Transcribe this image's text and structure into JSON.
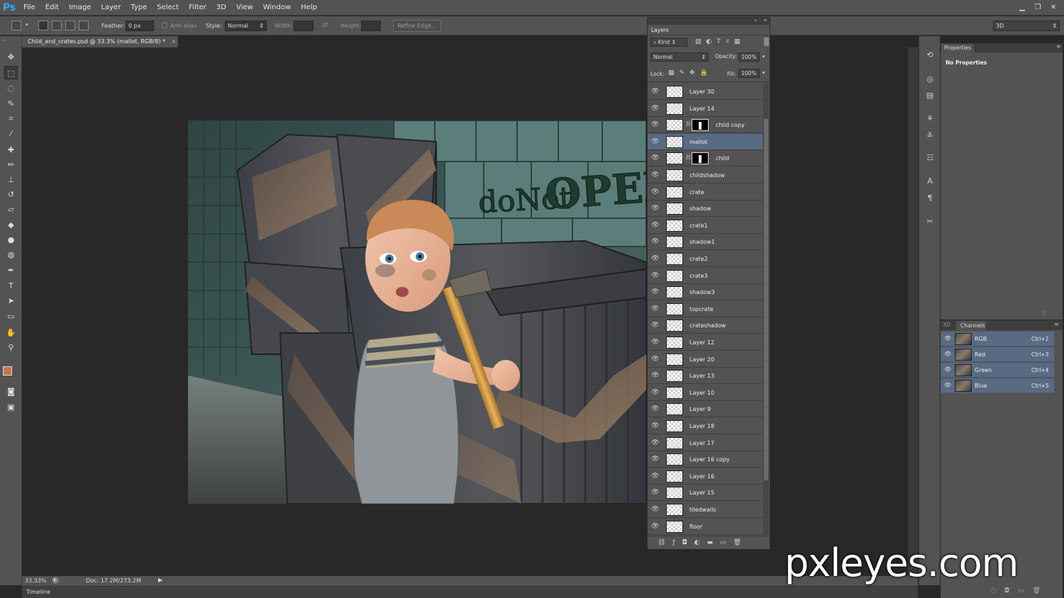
{
  "app": {
    "logo": "Ps",
    "menu": [
      "File",
      "Edit",
      "Image",
      "Layer",
      "Type",
      "Select",
      "Filter",
      "3D",
      "View",
      "Window",
      "Help"
    ]
  },
  "options": {
    "feather_label": "Feather:",
    "feather_value": "0 px",
    "antialias_label": "Anti-alias",
    "style_label": "Style:",
    "style_value": "Normal",
    "width_label": "Width:",
    "height_label": "Height:",
    "refine_edge": "Refine Edge...",
    "workspace": "3D"
  },
  "document": {
    "tab_title": "Child_and_crates.psd @ 33.3% (mallot, RGB/8) *",
    "close": "×",
    "sign_text_1": "doNot",
    "sign_text_2": "OPEN"
  },
  "status": {
    "zoom": "33.33%",
    "doc": "Doc: 17.2M/273.2M",
    "timeline": "Timeline"
  },
  "layers_panel": {
    "tab": "Layers",
    "kind": "Kind",
    "blend_mode": "Normal",
    "opacity_label": "Opacity:",
    "opacity_value": "100%",
    "lock_label": "Lock:",
    "fill_label": "Fill:",
    "fill_value": "100%",
    "layers": [
      {
        "name": "Layer 30",
        "selected": false,
        "mask": false
      },
      {
        "name": "Layer 14",
        "selected": false,
        "mask": false
      },
      {
        "name": "child copy",
        "selected": false,
        "mask": true
      },
      {
        "name": "mallot",
        "selected": true,
        "mask": false
      },
      {
        "name": "child",
        "selected": false,
        "mask": true
      },
      {
        "name": "childshadow",
        "selected": false,
        "mask": false
      },
      {
        "name": "crate",
        "selected": false,
        "mask": false
      },
      {
        "name": "shadow",
        "selected": false,
        "mask": false
      },
      {
        "name": "crate1",
        "selected": false,
        "mask": false
      },
      {
        "name": "shadow1",
        "selected": false,
        "mask": false
      },
      {
        "name": "crate2",
        "selected": false,
        "mask": false
      },
      {
        "name": "crate3",
        "selected": false,
        "mask": false
      },
      {
        "name": "shadow3",
        "selected": false,
        "mask": false
      },
      {
        "name": "topcrate",
        "selected": false,
        "mask": false
      },
      {
        "name": "crateshadow",
        "selected": false,
        "mask": false
      },
      {
        "name": "Layer 12",
        "selected": false,
        "mask": false
      },
      {
        "name": "Layer 20",
        "selected": false,
        "mask": false
      },
      {
        "name": "Layer 13",
        "selected": false,
        "mask": false
      },
      {
        "name": "Layer 10",
        "selected": false,
        "mask": false
      },
      {
        "name": "Layer 9",
        "selected": false,
        "mask": false
      },
      {
        "name": "Layer 18",
        "selected": false,
        "mask": false
      },
      {
        "name": "Layer 17",
        "selected": false,
        "mask": false
      },
      {
        "name": "Layer 16 copy",
        "selected": false,
        "mask": false
      },
      {
        "name": "Layer 16",
        "selected": false,
        "mask": false
      },
      {
        "name": "Layer 15",
        "selected": false,
        "mask": false
      },
      {
        "name": "tiledwalls",
        "selected": false,
        "mask": false
      },
      {
        "name": "floor",
        "selected": false,
        "mask": false
      }
    ]
  },
  "properties_panel": {
    "tab": "Properties",
    "content": "No Properties"
  },
  "channels_panel": {
    "tab_3d": "3D",
    "tab": "Channels",
    "channels": [
      {
        "name": "RGB",
        "shortcut": "Ctrl+2"
      },
      {
        "name": "Red",
        "shortcut": "Ctrl+3"
      },
      {
        "name": "Green",
        "shortcut": "Ctrl+4"
      },
      {
        "name": "Blue",
        "shortcut": "Ctrl+5"
      }
    ]
  },
  "watermark": "pxleyes.com",
  "colors": {
    "foreground": "#c8734e",
    "background": "#ffffff",
    "selection": "#596a83"
  }
}
